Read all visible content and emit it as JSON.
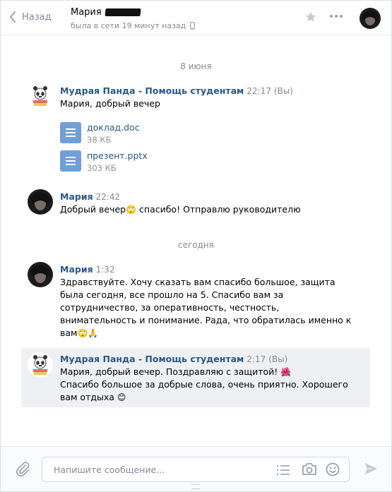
{
  "header": {
    "back_label": "Назад",
    "contact_name": "Мария",
    "status": "была в сети 19 минут назад"
  },
  "dates": [
    "8 июня",
    "сегодня"
  ],
  "messages": [
    {
      "author": "Мудрая Панда - Помощь студентам",
      "time": "22:17",
      "suffix": "(Вы)",
      "text": "Мария, добрый вечер",
      "docs": [
        {
          "name": "доклад.doc",
          "size": "38 КБ"
        },
        {
          "name": "презент.pptx",
          "size": "303 КБ"
        }
      ]
    },
    {
      "author": "Мария",
      "time": "22:42",
      "text_a": "Добрый вечер",
      "emoji_a": "🙄",
      "text_b": " спасибо! Отправлю руководителю"
    },
    {
      "author": "Мария",
      "time": "1:32",
      "lines": [
        "Здравствуйте. Хочу сказать вам спасибо большое, защита",
        "была сегодня, все прошло на 5. Спасибо вам за",
        "сотрудничество, за оперативность, честность,",
        "внимательность и понимание. Рада, что обратилась именно к"
      ],
      "last_text": "вам",
      "last_emoji": "🙄🙏"
    },
    {
      "author": "Мудрая Панда - Помощь студентам",
      "time": "2:17",
      "suffix": "(Вы)",
      "line1": "Мария, добрый вечер. Поздравляю с защитой!",
      "line1_emoji": "🌺",
      "line2": "Спасибо большое за добрые слова, очень приятно. Хорошего",
      "line3": "вам отдыха",
      "line3_emoji": "😊"
    }
  ],
  "composer": {
    "placeholder": "Напишите сообщение..."
  },
  "icons": {
    "back": "chevron-left-icon",
    "star": "star-icon",
    "more": "more-icon",
    "attach": "paperclip-icon",
    "template": "list-icon",
    "camera": "camera-icon",
    "emoji": "smile-icon",
    "send": "send-icon"
  },
  "colors": {
    "link": "#2a5885",
    "muted": "#828a99",
    "doc_icon": "#6f9fd8",
    "highlight": "#eef0f3"
  }
}
